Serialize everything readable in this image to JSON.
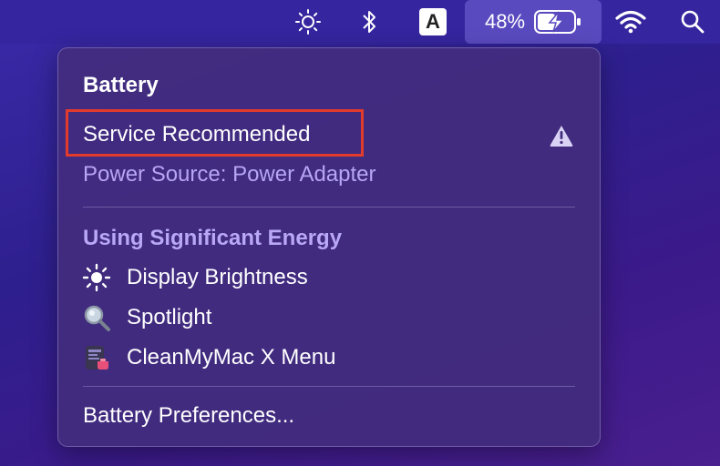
{
  "menubar": {
    "battery_percent": "48%",
    "input_source_letter": "A",
    "icons": [
      "brightness-icon",
      "bluetooth-icon",
      "input-source-icon",
      "battery-charging-icon",
      "wifi-icon",
      "search-icon"
    ]
  },
  "battery_menu": {
    "title": "Battery",
    "condition": "Service Recommended",
    "power_source": "Power Source: Power Adapter",
    "energy_section_title": "Using Significant Energy",
    "apps": [
      {
        "label": "Display Brightness",
        "icon": "sun-icon"
      },
      {
        "label": "Spotlight",
        "icon": "magnifier-icon"
      },
      {
        "label": "CleanMyMac X Menu",
        "icon": "cleanmymac-icon"
      }
    ],
    "preferences": "Battery Preferences..."
  },
  "colors": {
    "highlight_border": "#e23b2c",
    "section_title": "#b9a8f5",
    "menu_background": "#422c7e"
  }
}
